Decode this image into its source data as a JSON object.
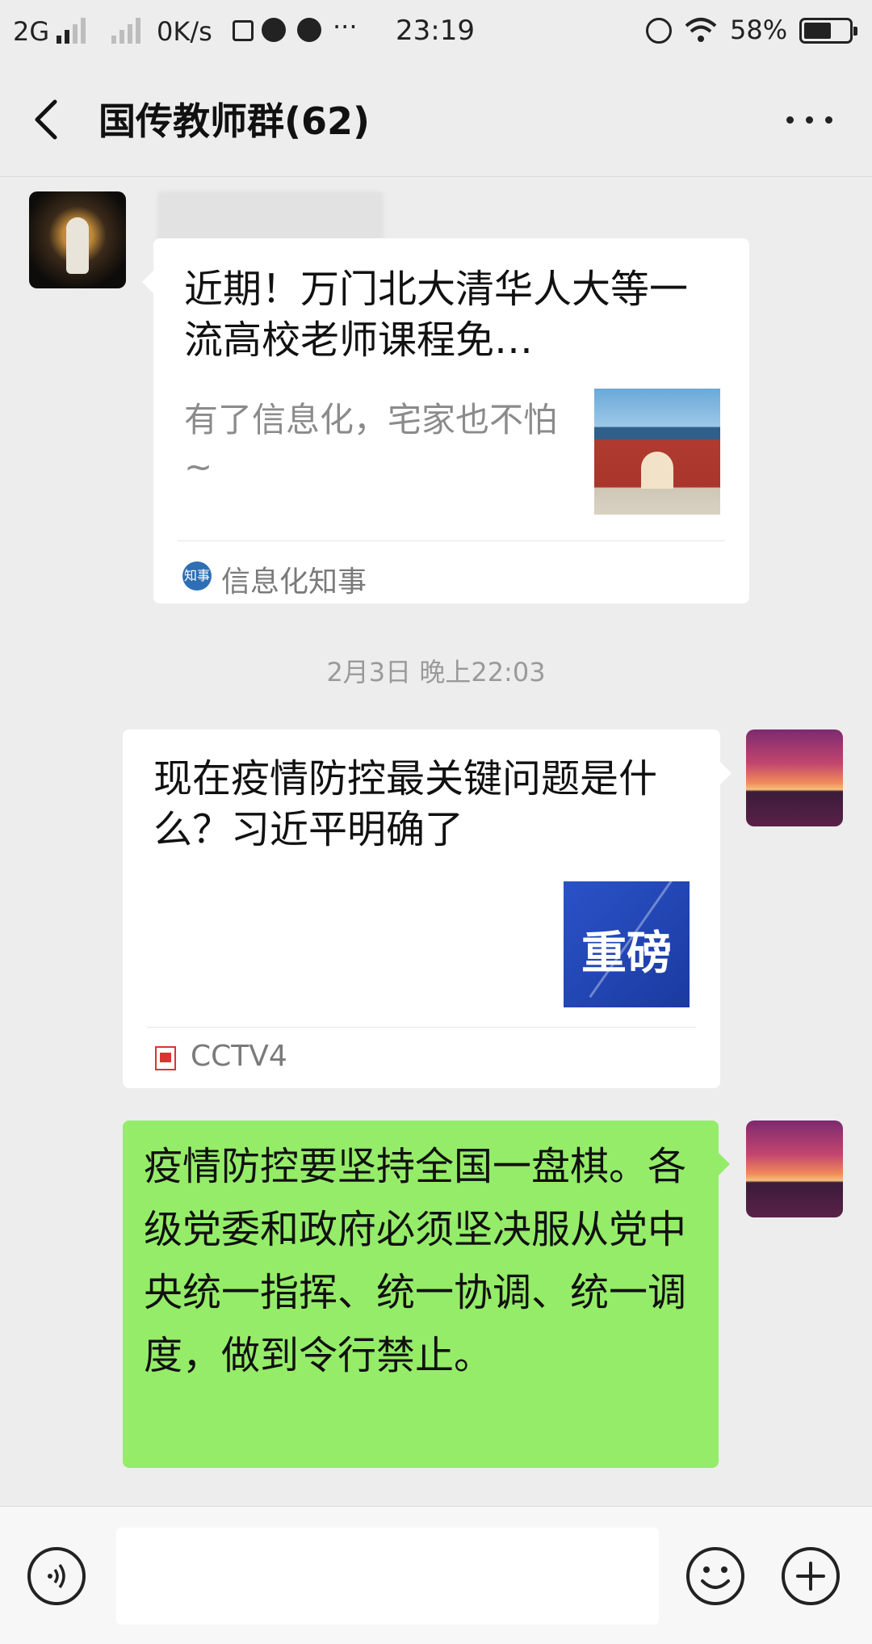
{
  "status_bar": {
    "network": "2G",
    "speed": "0K/s",
    "time": "23:19",
    "battery": "58%",
    "ellipsis": "···"
  },
  "header": {
    "title": "国传教师群(62)"
  },
  "messages": {
    "card1": {
      "title": "近期！万门北大清华人大等一流高校老师课程免…",
      "desc": "有了信息化，宅家也不怕~",
      "source": "信息化知事",
      "source_icon_text": "知事"
    },
    "timestamp": "2月3日 晚上22:03",
    "card2": {
      "title": "现在疫情防控最关键问题是什么？习近平明确了",
      "thumb_text": "重磅",
      "source": "CCTV4"
    },
    "text_bubble": "疫情防控要坚持全国一盘棋。各级党委和政府必须坚决服从党中央统一指挥、统一协调、统一调度，做到令行禁止。"
  },
  "colors": {
    "background": "#EDEDED",
    "sent_bubble": "#95EC69",
    "card": "#FFFFFF"
  },
  "icons": [
    "signal-icon",
    "speed-icon",
    "square-app-icon",
    "play-app-icon",
    "chat-app-icon",
    "alarm-icon",
    "wifi-icon",
    "battery-icon",
    "back-arrow-icon",
    "more-icon",
    "voice-icon",
    "emoji-icon",
    "plus-icon"
  ]
}
